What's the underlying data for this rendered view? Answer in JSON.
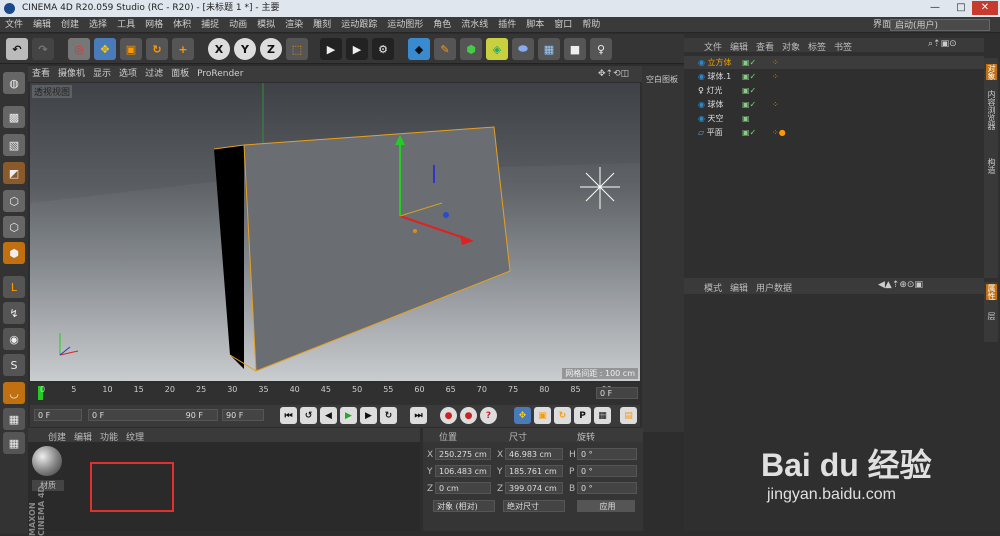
{
  "window": {
    "title": "CINEMA 4D R20.059 Studio (RC - R20) - [未标题 1 *] - 主要",
    "interface_label": "界面:",
    "interface_value": "启动(用户)",
    "controls": [
      "—",
      "□",
      "✕"
    ]
  },
  "menu": [
    "文件",
    "编辑",
    "创建",
    "选择",
    "工具",
    "网格",
    "体积",
    "捕捉",
    "动画",
    "模拟",
    "渲染",
    "雕刻",
    "运动跟踪",
    "运动图形",
    "角色",
    "流水线",
    "插件",
    "脚本",
    "窗口",
    "帮助"
  ],
  "toolbar": {
    "x": "X",
    "y": "Y",
    "z": "Z"
  },
  "viewport": {
    "menu": [
      "查看",
      "摄像机",
      "显示",
      "选项",
      "过滤",
      "面板",
      "ProRender"
    ],
    "label": "透视视图",
    "grid_info": "网格间距 : 100 cm",
    "side_tab": "空白图板"
  },
  "timeline": {
    "ticks": [
      "0",
      "5",
      "10",
      "15",
      "20",
      "25",
      "30",
      "35",
      "40",
      "45",
      "50",
      "55",
      "60",
      "65",
      "70",
      "75",
      "80",
      "85",
      "90"
    ],
    "frame_end": "0 F"
  },
  "playbar": {
    "current": "0 F",
    "range_start": "0 F",
    "range_end": "90 F",
    "max": "90 F"
  },
  "material": {
    "menu": [
      "创建",
      "编辑",
      "功能",
      "纹理"
    ],
    "item": "材质",
    "brand": "MAXON CINEMA 4D"
  },
  "coords": {
    "headers": [
      "位置",
      "尺寸",
      "旋转"
    ],
    "rows": [
      {
        "axis": "X",
        "pos": "250.275 cm",
        "saxis": "X",
        "size": "46.983 cm",
        "raxis": "H",
        "rot": "0 °"
      },
      {
        "axis": "Y",
        "pos": "106.483 cm",
        "saxis": "Y",
        "size": "185.761 cm",
        "raxis": "P",
        "rot": "0 °"
      },
      {
        "axis": "Z",
        "pos": "0 cm",
        "saxis": "Z",
        "size": "399.074 cm",
        "raxis": "B",
        "rot": "0 °"
      }
    ],
    "mode": "对象 (相对)",
    "size_mode": "绝对尺寸",
    "apply": "应用"
  },
  "objects": {
    "menu": [
      "文件",
      "编辑",
      "查看",
      "对象",
      "标签",
      "书签"
    ],
    "items": [
      {
        "name": "立方体",
        "active": true
      },
      {
        "name": "球体.1"
      },
      {
        "name": "灯光"
      },
      {
        "name": "球体"
      },
      {
        "name": "天空"
      },
      {
        "name": "平面"
      }
    ]
  },
  "attributes": {
    "menu": [
      "模式",
      "编辑",
      "用户数据"
    ]
  },
  "side_tabs": [
    "对象",
    "内容浏览器",
    "构造"
  ],
  "side_tabs2": [
    "属性",
    "层"
  ],
  "watermark": {
    "brand": "Bai du 经验",
    "url": "jingyan.baidu.com"
  },
  "colors": {
    "accent": "#f0a000",
    "selection": "#e08a1e"
  }
}
